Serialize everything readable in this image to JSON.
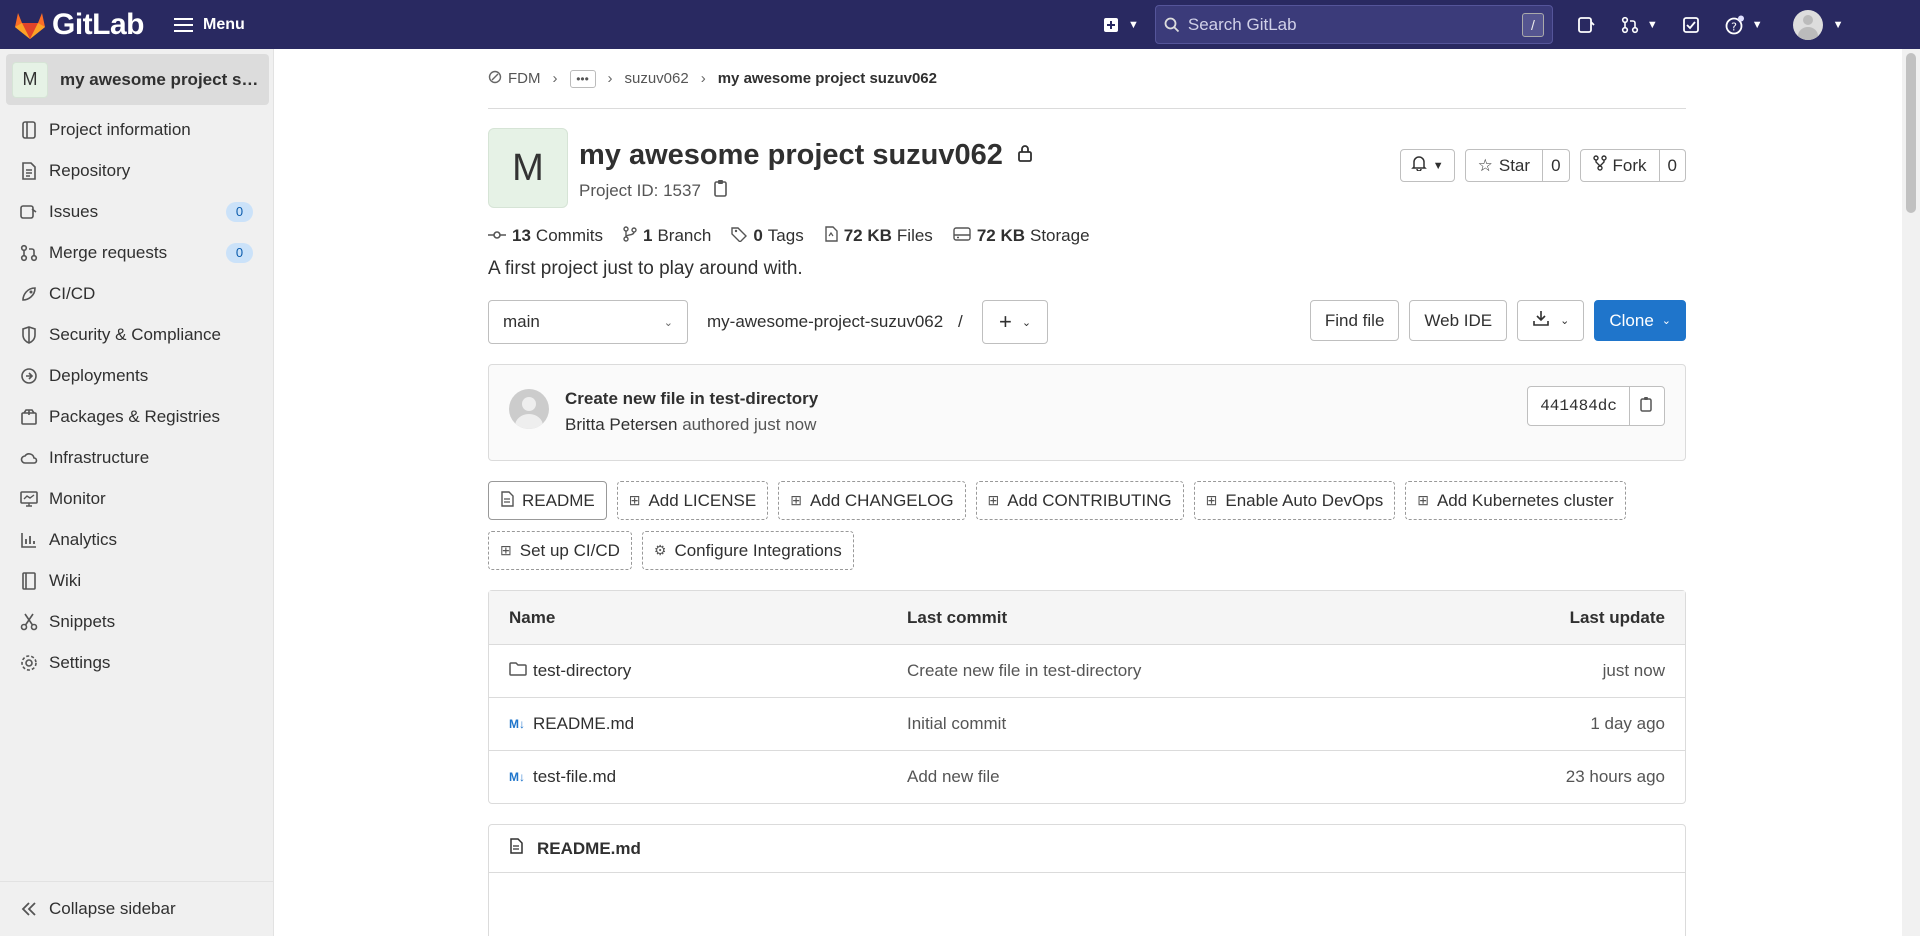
{
  "topbar": {
    "brand": "GitLab",
    "menu_label": "Menu",
    "search_placeholder": "Search GitLab",
    "search_shortcut": "/"
  },
  "sidebar": {
    "project_avatar": "M",
    "project_name": "my awesome project su...",
    "items": [
      {
        "label": "Project information",
        "icon": "info-icon"
      },
      {
        "label": "Repository",
        "icon": "document-icon"
      },
      {
        "label": "Issues",
        "icon": "issues-icon",
        "count": "0"
      },
      {
        "label": "Merge requests",
        "icon": "merge-request-icon",
        "count": "0"
      },
      {
        "label": "CI/CD",
        "icon": "rocket-icon"
      },
      {
        "label": "Security & Compliance",
        "icon": "shield-icon"
      },
      {
        "label": "Deployments",
        "icon": "deployments-icon"
      },
      {
        "label": "Packages & Registries",
        "icon": "package-icon"
      },
      {
        "label": "Infrastructure",
        "icon": "cloud-icon"
      },
      {
        "label": "Monitor",
        "icon": "monitor-icon"
      },
      {
        "label": "Analytics",
        "icon": "chart-icon"
      },
      {
        "label": "Wiki",
        "icon": "book-icon"
      },
      {
        "label": "Snippets",
        "icon": "scissors-icon"
      },
      {
        "label": "Settings",
        "icon": "gear-icon"
      }
    ],
    "collapse_label": "Collapse sidebar"
  },
  "breadcrumb": {
    "group": "FDM",
    "more": "•••",
    "user": "suzuv062",
    "current": "my awesome project suzuv062"
  },
  "project": {
    "avatar": "M",
    "title": "my awesome project suzuv062",
    "id_text": "Project ID: 1537",
    "star_label": "Star",
    "star_count": "0",
    "fork_label": "Fork",
    "fork_count": "0",
    "stats": {
      "commits_num": "13",
      "commits_label": "Commits",
      "branches_num": "1",
      "branches_label": "Branch",
      "tags_num": "0",
      "tags_label": "Tags",
      "files_num": "72 KB",
      "files_label": "Files",
      "storage_num": "72 KB",
      "storage_label": "Storage"
    },
    "description": "A first project just to play around with."
  },
  "repo_toolbar": {
    "branch": "main",
    "path_root": "my-awesome-project-suzuv062",
    "path_sep": "/",
    "find_file": "Find file",
    "web_ide": "Web IDE",
    "clone": "Clone"
  },
  "last_commit": {
    "title": "Create new file in test-directory",
    "author": "Britta Petersen",
    "meta": "authored just now",
    "sha": "441484dc"
  },
  "shortcuts": [
    {
      "label": "README",
      "style": "solid"
    },
    {
      "label": "Add LICENSE",
      "style": "dashed"
    },
    {
      "label": "Add CHANGELOG",
      "style": "dashed"
    },
    {
      "label": "Add CONTRIBUTING",
      "style": "dashed"
    },
    {
      "label": "Enable Auto DevOps",
      "style": "dashed"
    },
    {
      "label": "Add Kubernetes cluster",
      "style": "dashed"
    },
    {
      "label": "Set up CI/CD",
      "style": "dashed"
    },
    {
      "label": "Configure Integrations",
      "style": "dashed"
    }
  ],
  "file_table": {
    "headers": {
      "name": "Name",
      "commit": "Last commit",
      "update": "Last update"
    },
    "rows": [
      {
        "name": "test-directory",
        "type": "folder",
        "commit": "Create new file in test-directory",
        "update": "just now"
      },
      {
        "name": "README.md",
        "type": "markdown",
        "commit": "Initial commit",
        "update": "1 day ago"
      },
      {
        "name": "test-file.md",
        "type": "markdown",
        "commit": "Add new file",
        "update": "23 hours ago"
      }
    ]
  },
  "readme": {
    "title": "README.md"
  },
  "colors": {
    "topbar": "#292961",
    "primary": "#1f75cb",
    "logo_orange": "#fc6d26"
  }
}
